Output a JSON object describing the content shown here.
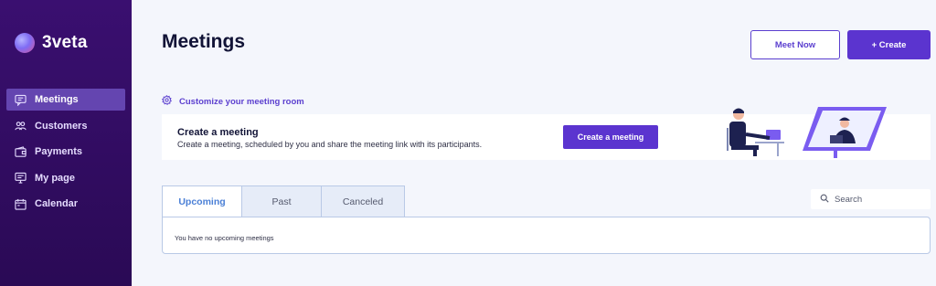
{
  "brand": {
    "name": "3veta"
  },
  "sidebar": {
    "items": [
      {
        "label": "Meetings",
        "icon": "chat-bubble-icon",
        "active": true
      },
      {
        "label": "Customers",
        "icon": "people-icon",
        "active": false
      },
      {
        "label": "Payments",
        "icon": "wallet-icon",
        "active": false
      },
      {
        "label": "My page",
        "icon": "monitor-icon",
        "active": false
      },
      {
        "label": "Calendar",
        "icon": "calendar-icon",
        "active": false
      }
    ]
  },
  "header": {
    "title": "Meetings",
    "meet_now_label": "Meet Now",
    "create_label": "+ Create"
  },
  "customize": {
    "label": "Customize your meeting room",
    "icon": "gear-icon"
  },
  "banner": {
    "title": "Create a meeting",
    "description": "Create a meeting, scheduled by you and share the meeting link with its participants.",
    "button_label": "Create a meeting"
  },
  "tabs": [
    {
      "label": "Upcoming",
      "active": true
    },
    {
      "label": "Past",
      "active": false
    },
    {
      "label": "Canceled",
      "active": false
    }
  ],
  "search": {
    "placeholder": "Search",
    "icon": "search-icon"
  },
  "panel": {
    "empty_text": "You have no upcoming meetings"
  },
  "colors": {
    "sidebar_bg": "#2d0b5c",
    "accent": "#5b34cf",
    "active_nav": "#6445b0",
    "tab_active_text": "#4a7fd6",
    "page_bg": "#f4f6fc"
  }
}
